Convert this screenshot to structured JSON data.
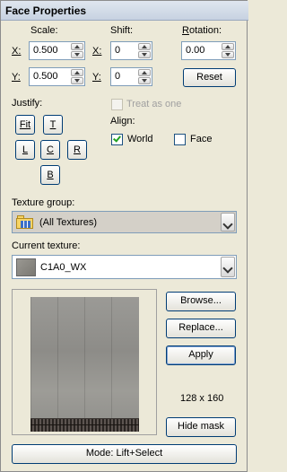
{
  "title": "Face Properties",
  "scale": {
    "label": "Scale:",
    "x_label": "X:",
    "y_label": "Y:",
    "x_value": "0.500",
    "y_value": "0.500"
  },
  "shift": {
    "label": "Shift:",
    "x_label": "X:",
    "y_label": "Y:",
    "x_value": "0",
    "y_value": "0"
  },
  "rotation": {
    "label": "Rotation:",
    "value": "0.00",
    "reset_label": "Reset"
  },
  "justify": {
    "label": "Justify:",
    "fit": "Fit",
    "top": "T",
    "left": "L",
    "center": "C",
    "right": "R",
    "bottom": "B"
  },
  "treat_as_one": {
    "label": "Treat as one",
    "checked": false,
    "enabled": false
  },
  "align": {
    "label": "Align:",
    "world_label": "World",
    "world_checked": true,
    "face_label": "Face",
    "face_checked": false
  },
  "texture_group": {
    "label": "Texture group:",
    "value": "(All Textures)"
  },
  "current_texture": {
    "label": "Current texture:",
    "value": "C1A0_WX"
  },
  "buttons": {
    "browse": "Browse...",
    "replace": "Replace...",
    "apply": "Apply",
    "hide_mask": "Hide mask",
    "mode": "Mode: Lift+Select"
  },
  "texture_size": "128 x 160"
}
